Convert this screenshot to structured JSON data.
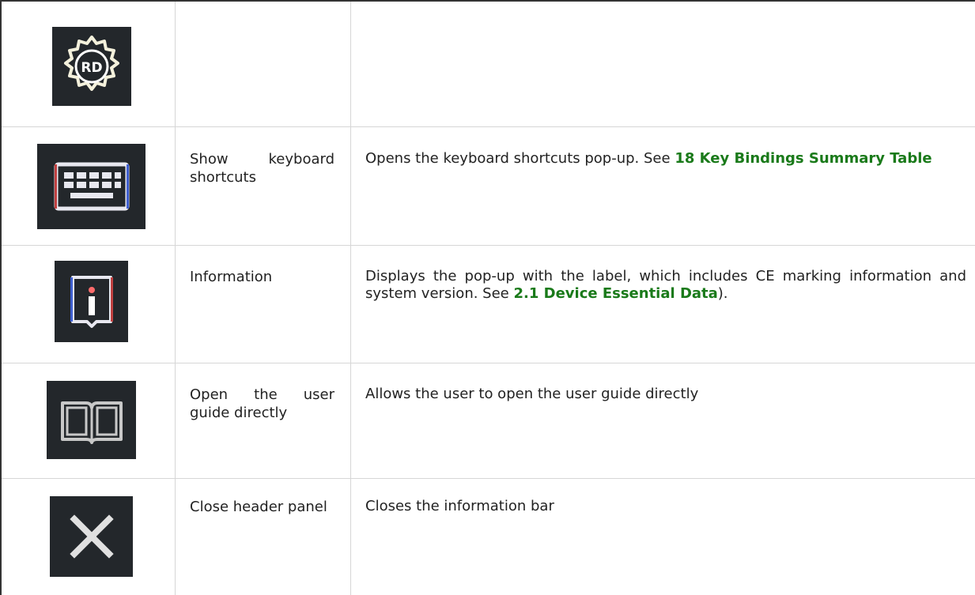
{
  "table": {
    "rows": [
      {
        "icon": "rd-gear-icon",
        "name": "",
        "desc": {
          "text": "",
          "link": "",
          "suffix": ""
        }
      },
      {
        "icon": "keyboard-icon",
        "name": "Show keyboard shortcuts",
        "desc": {
          "text": "Opens the keyboard shortcuts pop-up. See",
          "link": "18 Key Bindings Summary Table",
          "suffix": ""
        }
      },
      {
        "icon": "info-icon",
        "name": "Information",
        "desc": {
          "text": "Displays the pop‑up with the label, which includes CE marking information and system version. See",
          "link": "2.1 Device Essential Data",
          "suffix": ")."
        }
      },
      {
        "icon": "book-icon",
        "name": "Open the user guide directly",
        "desc": {
          "text": "Allows the user to open the user guide directly",
          "link": "",
          "suffix": ""
        }
      },
      {
        "icon": "close-icon",
        "name": "Close header panel",
        "desc": {
          "text": "Closes the information bar",
          "link": "",
          "suffix": ""
        }
      }
    ]
  },
  "colors": {
    "icon_bg": "#23272b",
    "link": "#1a7a1a",
    "rule": "#d6d6d6"
  }
}
